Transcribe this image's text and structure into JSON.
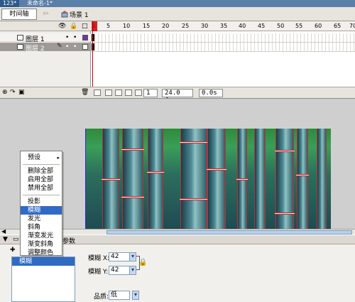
{
  "doc_tabs": [
    "123*",
    "未命名-1*"
  ],
  "timeline_bar": {
    "tab_label": "时间轴",
    "back_arrow": "⇦",
    "scene_label": "场景 1"
  },
  "layer_header": {
    "eye": "👁",
    "lock": "🔒",
    "outline": "□"
  },
  "layers": [
    {
      "name": "图层 1",
      "visible_dot": "•",
      "lock_dot": "•",
      "color": "#7a2fb0"
    },
    {
      "name": "图层 2",
      "visible_dot": "•",
      "lock_dot": "•",
      "color": "#ffffff"
    }
  ],
  "ruler_ticks": [
    "1",
    "5",
    "10",
    "15",
    "20",
    "25",
    "30",
    "35",
    "40",
    "45",
    "50",
    "55",
    "60",
    "65",
    "70"
  ],
  "status": {
    "frame": "1",
    "fps": "24.0 fps",
    "time": "0.0s"
  },
  "context_menu": {
    "items": [
      "预设",
      "删除全部",
      "启用全部",
      "禁用全部",
      "投影",
      "模糊",
      "发光",
      "斜角",
      "渐变发光",
      "渐变斜角",
      "调整颜色"
    ],
    "submenu_arrow": "▸",
    "selected_index": 5
  },
  "props": {
    "tab_label": "参数",
    "filter_list": [
      "模糊"
    ],
    "blur_x_label": "模糊 X:",
    "blur_x_value": "42",
    "blur_y_label": "模糊 Y:",
    "blur_y_value": "42",
    "quality_label": "品质:",
    "quality_value": "低"
  },
  "colors": {
    "accent": "#316ac5",
    "playhead": "#cc0000"
  }
}
